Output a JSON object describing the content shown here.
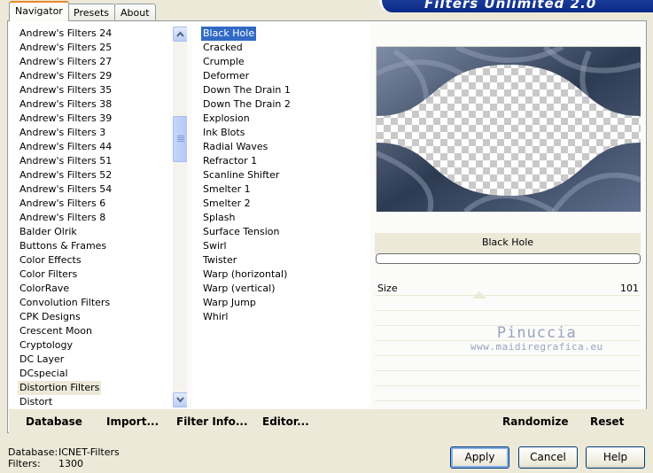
{
  "tabs": [
    {
      "label": "Navigator"
    },
    {
      "label": "Presets"
    },
    {
      "label": "About"
    }
  ],
  "banner": {
    "text": "Filters Unlimited 2.0"
  },
  "filter_categories": [
    "Andrew's Filters 24",
    "Andrew's Filters 25",
    "Andrew's Filters 27",
    "Andrew's Filters 29",
    "Andrew's Filters 35",
    "Andrew's Filters 38",
    "Andrew's Filters 39",
    "Andrew's Filters 3",
    "Andrew's Filters 44",
    "Andrew's Filters 51",
    "Andrew's Filters 52",
    "Andrew's Filters 54",
    "Andrew's Filters 6",
    "Andrew's Filters 8",
    "Balder Olrik",
    "Buttons & Frames",
    "Color Effects",
    "Color Filters",
    "ColorRave",
    "Convolution Filters",
    "CPK Designs",
    "Crescent Moon",
    "Cryptology",
    "DC Layer",
    "DCspecial",
    "Distortion Filters",
    "Distort"
  ],
  "selected_category": "Distortion Filters",
  "effects": [
    "Black Hole",
    "Cracked",
    "Crumple",
    "Deformer",
    "Down The Drain 1",
    "Down The Drain 2",
    "Explosion",
    "Ink Blots",
    "Radial Waves",
    "Refractor 1",
    "Scanline Shifter",
    "Smelter 1",
    "Smelter 2",
    "Splash",
    "Surface Tension",
    "Swirl",
    "Twister",
    "Warp (horizontal)",
    "Warp (vertical)",
    "Warp Jump",
    "Whirl"
  ],
  "selected_effect": "Black Hole",
  "effect_title": "Black Hole",
  "params": [
    {
      "label": "Size",
      "value": "101"
    }
  ],
  "watermark": {
    "line1": "Pinuccia",
    "line2": "www.maidiregrafica.eu"
  },
  "bottom_bar": {
    "database": "Database",
    "import": "Import...",
    "filter_info": "Filter Info...",
    "editor": "Editor...",
    "randomize": "Randomize",
    "reset": "Reset"
  },
  "status": {
    "database_label": "Database:",
    "database_value": "ICNET-Filters",
    "filters_label": "Filters:",
    "filters_value": "1300"
  },
  "buttons": {
    "apply": "Apply",
    "cancel": "Cancel",
    "help": "Help"
  },
  "colors": {
    "selection": "#316ac5",
    "preview_pattern": "#2d3b52"
  }
}
